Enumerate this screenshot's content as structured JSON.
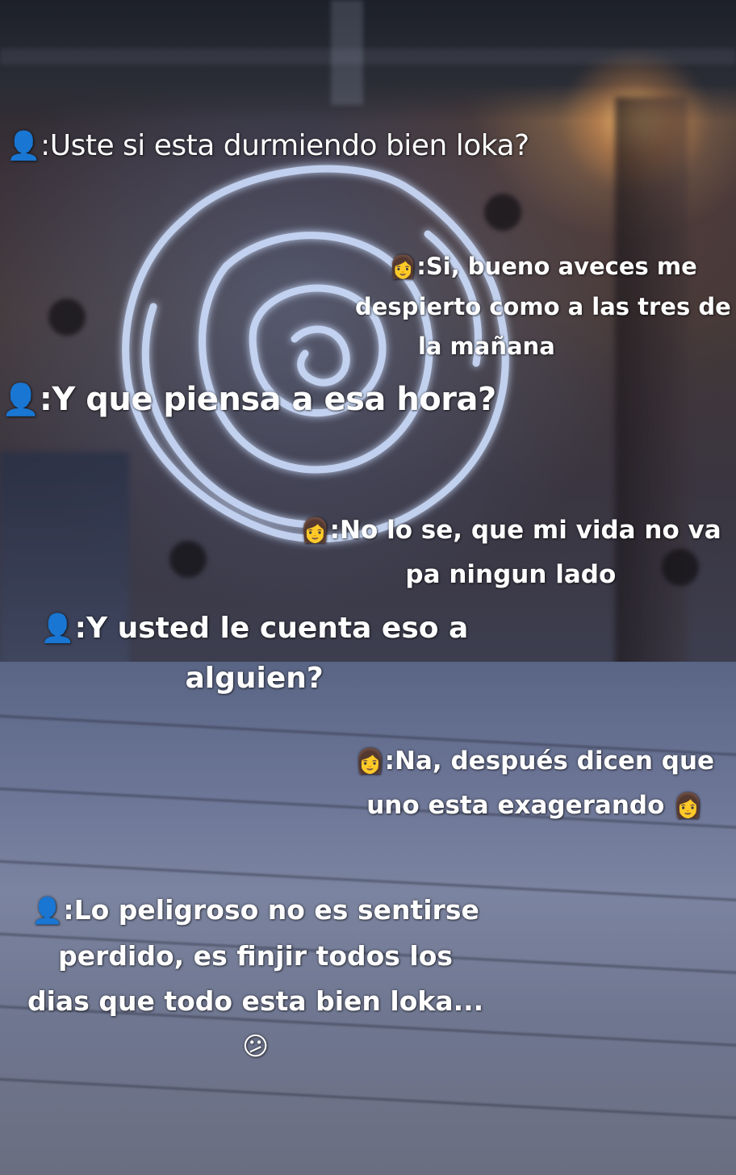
{
  "messages": [
    {
      "speaker_icon": "person-silhouette-icon",
      "lines": [
        "Uste si esta durmiendo bien loka?"
      ],
      "prefix": ":"
    },
    {
      "speaker_icon": "woman-icon",
      "lines": [
        ":Si, bueno aveces me",
        "despierto como a las tres de",
        "la mañana"
      ]
    },
    {
      "speaker_icon": "person-silhouette-icon",
      "lines": [
        ":Y que piensa a esa hora?"
      ]
    },
    {
      "speaker_icon": "woman-icon",
      "lines": [
        ":No lo se, que mi vida no va",
        "pa ningun lado"
      ]
    },
    {
      "speaker_icon": "person-silhouette-icon",
      "lines": [
        ":Y usted le cuenta eso a",
        "alguien?"
      ]
    },
    {
      "speaker_icon": "woman-icon",
      "lines": [
        ":Na, después dicen que",
        "uno esta exagerando"
      ],
      "trailing_emoji": "woman-icon"
    },
    {
      "speaker_icon": "person-silhouette-icon",
      "lines": [
        ":Lo peligroso no es sentirse",
        "perdido, es finjir todos los",
        "dias que todo esta bien loka..."
      ],
      "trailing_emoji": "confused-face-icon"
    }
  ],
  "emojis": {
    "person-silhouette-icon": "👤",
    "woman-icon": "👩",
    "confused-face-icon": "😕"
  },
  "colors": {
    "text": "#ffffff",
    "rose_glow": "#cfe0ff"
  }
}
